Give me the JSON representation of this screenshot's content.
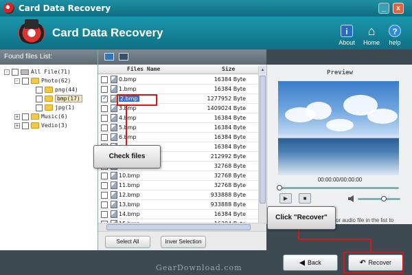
{
  "window": {
    "title": "Card Data Recovery",
    "min_label": "_",
    "close_label": "x"
  },
  "header": {
    "app_title": "Card Data Recovery",
    "buttons": [
      {
        "label": "About",
        "icon": "about-icon",
        "glyph": "i"
      },
      {
        "label": "Home",
        "icon": "home-icon",
        "glyph": "⌂"
      },
      {
        "label": "help",
        "icon": "help-icon",
        "glyph": "?"
      }
    ]
  },
  "left_panel": {
    "title": "Found files List:",
    "tree": [
      {
        "label": "All File(71)",
        "expander": "-"
      },
      {
        "label": "Photo(62)",
        "expander": "-"
      },
      {
        "label": "png(44)"
      },
      {
        "label": "bmp(17)",
        "selected": true
      },
      {
        "label": "jpg(1)"
      },
      {
        "label": "Music(6)",
        "expander": "+"
      },
      {
        "label": "Vedio(3)",
        "expander": "+"
      }
    ]
  },
  "file_list": {
    "columns": [
      "Files Name",
      "Size"
    ],
    "rows": [
      {
        "name": "0.bmp",
        "size": "16384 Byte",
        "checked": false
      },
      {
        "name": "1.bmp",
        "size": "16384 Byte",
        "checked": false
      },
      {
        "name": "2.bmp",
        "size": "1277952 Byte",
        "checked": true
      },
      {
        "name": "3.bmp",
        "size": "1409024 Byte",
        "checked": false
      },
      {
        "name": "4.bmp",
        "size": "16384 Byte",
        "checked": false
      },
      {
        "name": "5.bmp",
        "size": "16384 Byte",
        "checked": false
      },
      {
        "name": "6.bmp",
        "size": "16384 Byte",
        "checked": false
      },
      {
        "name": "",
        "size": "16384 Byte",
        "checked": false
      },
      {
        "name": "",
        "size": "212992 Byte",
        "checked": false
      },
      {
        "name": "",
        "size": "32768 Byte",
        "checked": false
      },
      {
        "name": "10.bmp",
        "size": "32768 Byte",
        "checked": false
      },
      {
        "name": "11.bmp",
        "size": "32768 Byte",
        "checked": false
      },
      {
        "name": "12.bmp",
        "size": "933888 Byte",
        "checked": false
      },
      {
        "name": "13.bmp",
        "size": "933888 Byte",
        "checked": false
      },
      {
        "name": "14.bmp",
        "size": "16384 Byte",
        "checked": false
      },
      {
        "name": "15.bmp",
        "size": "16384 Byte",
        "checked": false
      }
    ],
    "select_all_label": "Select All",
    "invert_label": "Inver Selection"
  },
  "preview": {
    "title": "Preview",
    "time": "00:00:00/00:00:00",
    "message": "or audio file in the list to",
    "play_glyph": "▶",
    "stop_glyph": "■"
  },
  "callouts": {
    "check_files": "Check files",
    "click_recover": "Click \"Recover\""
  },
  "footer": {
    "watermark": "GearDownload.com",
    "back_label": "Back",
    "recover_label": "Recover"
  },
  "colors": {
    "accent": "#1a97ad",
    "highlight": "#d01a1a",
    "selection": "#2f6fd6"
  }
}
